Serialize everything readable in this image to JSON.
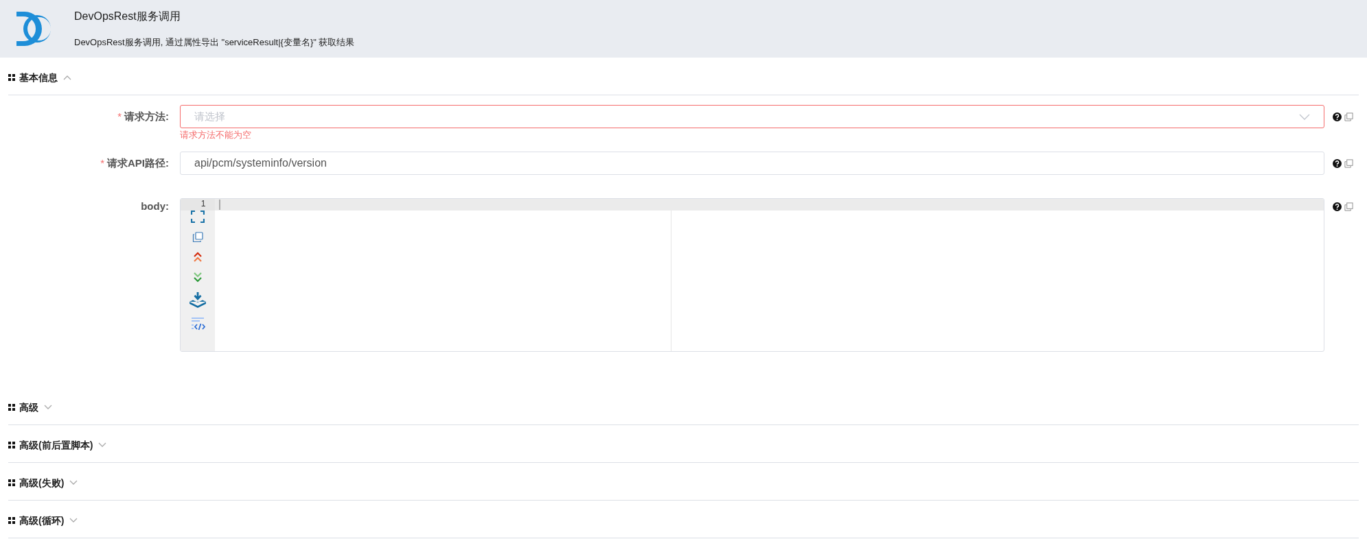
{
  "header": {
    "title": "DevOpsRest服务调用",
    "subtitle": "DevOpsRest服务调用, 通过属性导出 \"serviceResult|{变量名}\" 获取结果"
  },
  "sections": [
    {
      "title": "基本信息",
      "expanded": true,
      "fields": [
        {
          "kind": "select",
          "required_mark": "*",
          "label": "请求方法:",
          "placeholder": "请选择",
          "error": "请求方法不能为空"
        },
        {
          "kind": "text",
          "required_mark": "*",
          "label": "请求API路径:",
          "value": "api/pcm/systeminfo/version"
        },
        {
          "kind": "code",
          "label": "body:",
          "line_numbers": [
            "1"
          ]
        }
      ]
    },
    {
      "title": "高级",
      "expanded": false
    },
    {
      "title": "高级(前后置脚本)",
      "expanded": false
    },
    {
      "title": "高级(失败)",
      "expanded": false
    },
    {
      "title": "高级(循环)",
      "expanded": false
    }
  ]
}
